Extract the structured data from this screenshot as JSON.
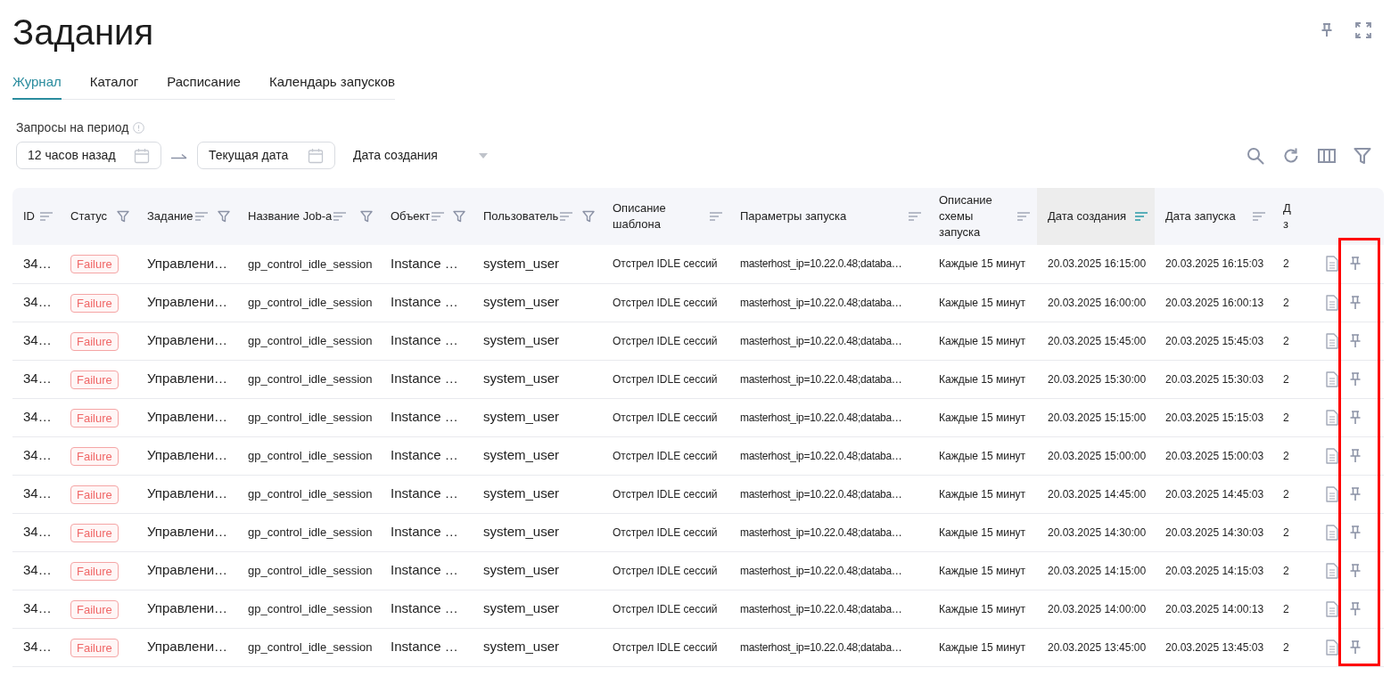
{
  "page": {
    "title": "Задания"
  },
  "tabs": [
    {
      "label": "Журнал",
      "selected": true
    },
    {
      "label": "Каталог",
      "selected": false
    },
    {
      "label": "Расписание",
      "selected": false
    },
    {
      "label": "Календарь запусков",
      "selected": false
    }
  ],
  "filters": {
    "label": "Запросы на период",
    "from": {
      "value": "12 часов назад"
    },
    "to": {
      "value": "Текущая дата"
    },
    "date_field": {
      "value": "Дата создания"
    }
  },
  "table": {
    "pin_column_highlighted": true,
    "columns": [
      {
        "label": "ID",
        "kind": "text",
        "sortable": true,
        "filterable": false,
        "sorted": false
      },
      {
        "label": "Статус",
        "kind": "badge",
        "sortable": false,
        "filterable": true
      },
      {
        "label": "Задание",
        "kind": "text",
        "sortable": true,
        "filterable": true,
        "sorted": false
      },
      {
        "label": "Название Job-а",
        "kind": "text",
        "sortable": true,
        "filterable": true,
        "sorted": false
      },
      {
        "label": "Объект",
        "kind": "text",
        "sortable": true,
        "filterable": true,
        "sorted": false
      },
      {
        "label": "Пользователь",
        "kind": "text",
        "sortable": true,
        "filterable": true,
        "sorted": false
      },
      {
        "label": "Описание шаблона",
        "kind": "text",
        "sortable": true,
        "filterable": false,
        "sorted": false
      },
      {
        "label": "Параметры запуска",
        "kind": "text",
        "sortable": true,
        "filterable": false,
        "sorted": false
      },
      {
        "label": "Описание схемы запуска",
        "kind": "text",
        "sortable": true,
        "filterable": false,
        "sorted": false
      },
      {
        "label": "Дата создания",
        "kind": "text",
        "sortable": true,
        "filterable": false,
        "sorted": true
      },
      {
        "label": "Дата запуска",
        "kind": "text",
        "sortable": true,
        "filterable": false,
        "sorted": false
      },
      {
        "label": "Д з",
        "kind": "text",
        "sortable": false,
        "filterable": false
      }
    ],
    "rows": [
      {
        "cells": [
          "34…",
          "Failure",
          "Управлени…",
          "gp_control_idle_session",
          "Instance …",
          "system_user",
          "Отстрел IDLE сессий",
          "masterhost_ip=10.22.0.48;databa…",
          "Каждые 15 минут",
          "20.03.2025 16:15:00",
          "20.03.2025 16:15:03",
          "2"
        ]
      },
      {
        "cells": [
          "34…",
          "Failure",
          "Управлени…",
          "gp_control_idle_session",
          "Instance …",
          "system_user",
          "Отстрел IDLE сессий",
          "masterhost_ip=10.22.0.48;databa…",
          "Каждые 15 минут",
          "20.03.2025 16:00:00",
          "20.03.2025 16:00:13",
          "2"
        ]
      },
      {
        "cells": [
          "34…",
          "Failure",
          "Управлени…",
          "gp_control_idle_session",
          "Instance …",
          "system_user",
          "Отстрел IDLE сессий",
          "masterhost_ip=10.22.0.48;databa…",
          "Каждые 15 минут",
          "20.03.2025 15:45:00",
          "20.03.2025 15:45:03",
          "2"
        ]
      },
      {
        "cells": [
          "34…",
          "Failure",
          "Управлени…",
          "gp_control_idle_session",
          "Instance …",
          "system_user",
          "Отстрел IDLE сессий",
          "masterhost_ip=10.22.0.48;databa…",
          "Каждые 15 минут",
          "20.03.2025 15:30:00",
          "20.03.2025 15:30:03",
          "2"
        ]
      },
      {
        "cells": [
          "34…",
          "Failure",
          "Управлени…",
          "gp_control_idle_session",
          "Instance …",
          "system_user",
          "Отстрел IDLE сессий",
          "masterhost_ip=10.22.0.48;databa…",
          "Каждые 15 минут",
          "20.03.2025 15:15:00",
          "20.03.2025 15:15:03",
          "2"
        ]
      },
      {
        "cells": [
          "34…",
          "Failure",
          "Управлени…",
          "gp_control_idle_session",
          "Instance …",
          "system_user",
          "Отстрел IDLE сессий",
          "masterhost_ip=10.22.0.48;databa…",
          "Каждые 15 минут",
          "20.03.2025 15:00:00",
          "20.03.2025 15:00:03",
          "2"
        ]
      },
      {
        "cells": [
          "34…",
          "Failure",
          "Управлени…",
          "gp_control_idle_session",
          "Instance …",
          "system_user",
          "Отстрел IDLE сессий",
          "masterhost_ip=10.22.0.48;databa…",
          "Каждые 15 минут",
          "20.03.2025 14:45:00",
          "20.03.2025 14:45:03",
          "2"
        ]
      },
      {
        "cells": [
          "34…",
          "Failure",
          "Управлени…",
          "gp_control_idle_session",
          "Instance …",
          "system_user",
          "Отстрел IDLE сессий",
          "masterhost_ip=10.22.0.48;databa…",
          "Каждые 15 минут",
          "20.03.2025 14:30:00",
          "20.03.2025 14:30:03",
          "2"
        ]
      },
      {
        "cells": [
          "34…",
          "Failure",
          "Управлени…",
          "gp_control_idle_session",
          "Instance …",
          "system_user",
          "Отстрел IDLE сессий",
          "masterhost_ip=10.22.0.48;databa…",
          "Каждые 15 минут",
          "20.03.2025 14:15:00",
          "20.03.2025 14:15:03",
          "2"
        ]
      },
      {
        "cells": [
          "34…",
          "Failure",
          "Управлени…",
          "gp_control_idle_session",
          "Instance …",
          "system_user",
          "Отстрел IDLE сессий",
          "masterhost_ip=10.22.0.48;databa…",
          "Каждые 15 минут",
          "20.03.2025 14:00:00",
          "20.03.2025 14:00:13",
          "2"
        ]
      },
      {
        "cells": [
          "34…",
          "Failure",
          "Управлени…",
          "gp_control_idle_session",
          "Instance …",
          "system_user",
          "Отстрел IDLE сессий",
          "masterhost_ip=10.22.0.48;databa…",
          "Каждые 15 минут",
          "20.03.2025 13:45:00",
          "20.03.2025 13:45:03",
          "2"
        ]
      }
    ]
  }
}
